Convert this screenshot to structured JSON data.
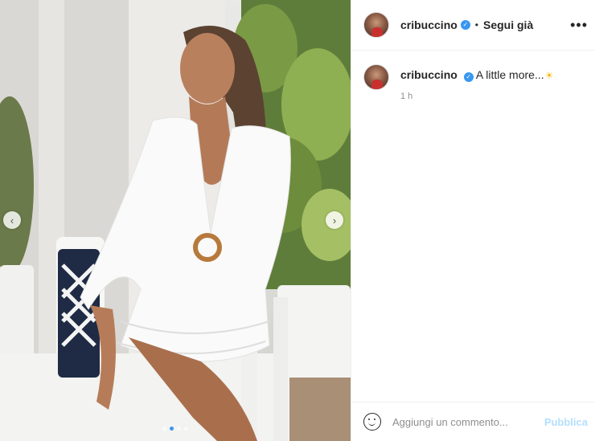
{
  "post": {
    "username": "cribuccino",
    "follow_label": "Segui già",
    "separator": "•",
    "more_label": "•••",
    "nav_prev": "‹",
    "nav_next": "›",
    "slides": {
      "count": 4,
      "active_index": 1
    }
  },
  "caption": {
    "username": "cribuccino",
    "text": "A little more...",
    "emoji": "☀",
    "time": "1 h"
  },
  "comment": {
    "placeholder": "Aggiungi un commento...",
    "publish_label": "Pubblica"
  },
  "icons": {
    "verified": "verified-badge-icon",
    "emoji": "emoji-smiley-icon",
    "more": "more-options-icon"
  },
  "colors": {
    "verified_blue": "#3897f0",
    "publish_disabled": "#b2dffc",
    "active_dot": "#3897f0"
  }
}
